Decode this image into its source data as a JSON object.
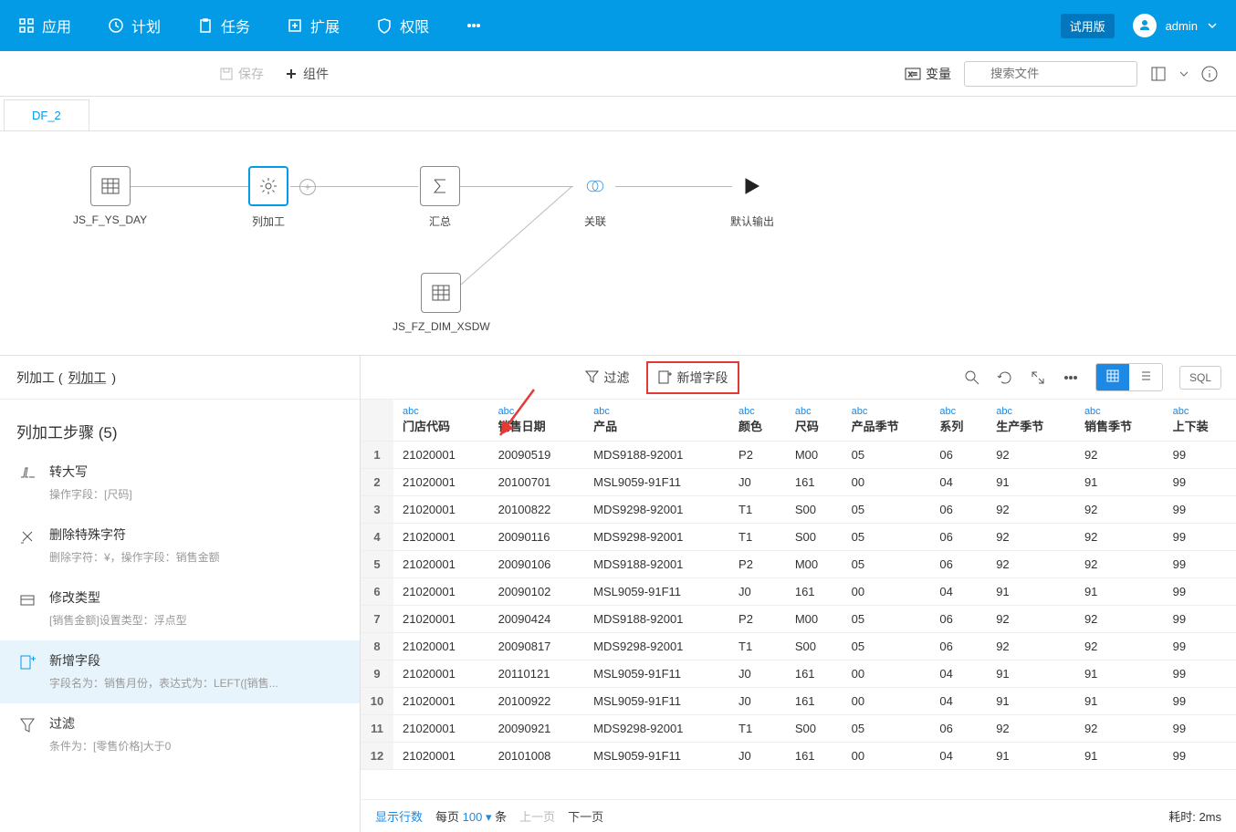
{
  "nav": {
    "app": "应用",
    "plan": "计划",
    "task": "任务",
    "ext": "扩展",
    "perm": "权限"
  },
  "header": {
    "trial": "试用版",
    "user": "admin"
  },
  "toolbar": {
    "save": "保存",
    "component": "组件",
    "variable": "变量",
    "search_ph": "搜索文件"
  },
  "tab": {
    "name": "DF_2"
  },
  "nodes": {
    "n1": "JS_F_YS_DAY",
    "n2": "列加工",
    "n3": "汇总",
    "n4": "关联",
    "n5": "默认输出",
    "n6": "JS_FZ_DIM_XSDW"
  },
  "panel": {
    "title_label": "列加工",
    "title_value": "列加工",
    "steps_title": "列加工步骤",
    "steps_count": "(5)"
  },
  "steps": [
    {
      "title": "转大写",
      "desc": "操作字段：[尺码]"
    },
    {
      "title": "删除特殊字符",
      "desc": "删除字符：¥，操作字段：销售金额"
    },
    {
      "title": "修改类型",
      "desc": "[销售金额]设置类型：浮点型"
    },
    {
      "title": "新增字段",
      "desc": "字段名为：销售月份，表达式为：LEFT([销售..."
    },
    {
      "title": "过滤",
      "desc": "条件为：[零售价格]大于0"
    }
  ],
  "main_toolbar": {
    "filter": "过滤",
    "newfield": "新增字段",
    "sql": "SQL"
  },
  "columns": [
    "门店代码",
    "销售日期",
    "产品",
    "颜色",
    "尺码",
    "产品季节",
    "系列",
    "生产季节",
    "销售季节",
    "上下装"
  ],
  "dtype": "abc",
  "rows": [
    [
      "21020001",
      "20090519",
      "MDS9188-92001",
      "P2",
      "M00",
      "05",
      "06",
      "92",
      "92",
      "99"
    ],
    [
      "21020001",
      "20100701",
      "MSL9059-91F11",
      "J0",
      "161",
      "00",
      "04",
      "91",
      "91",
      "99"
    ],
    [
      "21020001",
      "20100822",
      "MDS9298-92001",
      "T1",
      "S00",
      "05",
      "06",
      "92",
      "92",
      "99"
    ],
    [
      "21020001",
      "20090116",
      "MDS9298-92001",
      "T1",
      "S00",
      "05",
      "06",
      "92",
      "92",
      "99"
    ],
    [
      "21020001",
      "20090106",
      "MDS9188-92001",
      "P2",
      "M00",
      "05",
      "06",
      "92",
      "92",
      "99"
    ],
    [
      "21020001",
      "20090102",
      "MSL9059-91F11",
      "J0",
      "161",
      "00",
      "04",
      "91",
      "91",
      "99"
    ],
    [
      "21020001",
      "20090424",
      "MDS9188-92001",
      "P2",
      "M00",
      "05",
      "06",
      "92",
      "92",
      "99"
    ],
    [
      "21020001",
      "20090817",
      "MDS9298-92001",
      "T1",
      "S00",
      "05",
      "06",
      "92",
      "92",
      "99"
    ],
    [
      "21020001",
      "20110121",
      "MSL9059-91F11",
      "J0",
      "161",
      "00",
      "04",
      "91",
      "91",
      "99"
    ],
    [
      "21020001",
      "20100922",
      "MSL9059-91F11",
      "J0",
      "161",
      "00",
      "04",
      "91",
      "91",
      "99"
    ],
    [
      "21020001",
      "20090921",
      "MDS9298-92001",
      "T1",
      "S00",
      "05",
      "06",
      "92",
      "92",
      "99"
    ],
    [
      "21020001",
      "20101008",
      "MSL9059-91F11",
      "J0",
      "161",
      "00",
      "04",
      "91",
      "91",
      "99"
    ]
  ],
  "pager": {
    "show": "显示行数",
    "per_page": "每页",
    "count": "100",
    "suffix": "条",
    "prev": "上一页",
    "next": "下一页",
    "time_label": "耗时:",
    "time_val": "2ms"
  }
}
